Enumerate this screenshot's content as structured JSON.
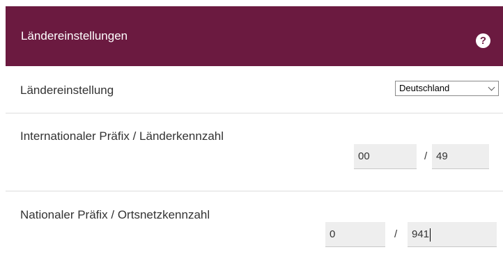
{
  "header": {
    "title": "Ländereinstellungen",
    "help_icon": "help-icon"
  },
  "country": {
    "label": "Ländereinstellung",
    "selected": "Deutschland",
    "chevron_icon": "chevron-down-icon"
  },
  "international": {
    "label": "Internationaler Präfix / Länderkennzahl",
    "prefix": "00",
    "separator": "/",
    "country_code": "49"
  },
  "national": {
    "label": "Nationaler Präfix / Ortsnetzkennzahl",
    "prefix": "0",
    "separator": "/",
    "area_code": "941"
  },
  "colors": {
    "header_bg": "#6b1a40",
    "input_bg": "#eeeeee",
    "divider": "#dddddd"
  }
}
